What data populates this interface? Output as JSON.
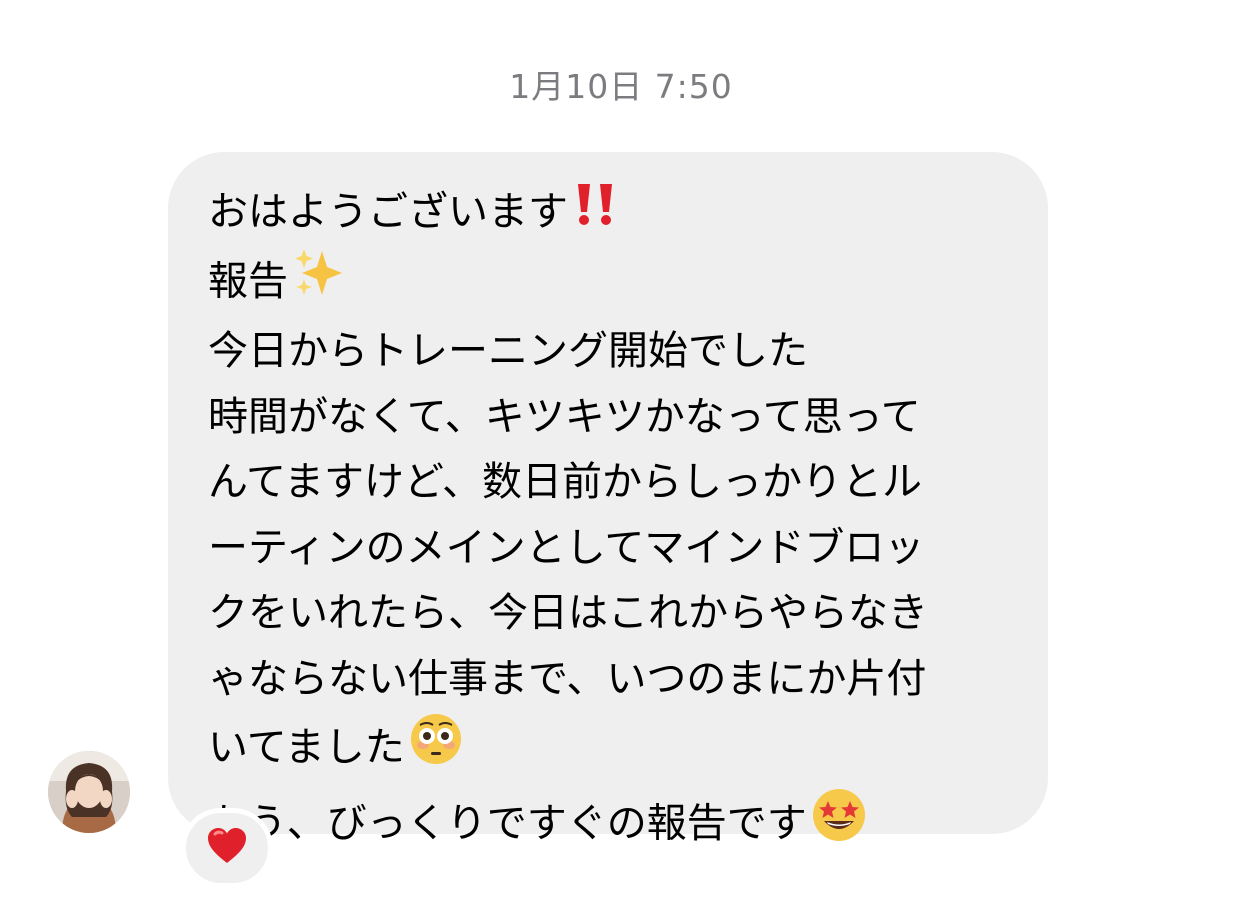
{
  "thread": {
    "timestamp": "1月10日 7:50"
  },
  "message": {
    "lines": [
      "おはようございます",
      "報告",
      "今日からトレーニング開始でした",
      "時間がなくて、キツキツかなって思って",
      "んてますけど、数日前からしっかりとル",
      "ーティンのメインとしてマインドブロッ",
      "クをいれたら、今日はこれからやらなき",
      "ゃならない仕事まで、いつのまにか片付",
      "いてました",
      "もう、びっくりですぐの報告です"
    ],
    "emojis": {
      "line1": "double-exclamation-icon",
      "line2": "sparkles-icon",
      "line9": "flushed-face-icon",
      "line10": "star-struck-face-icon"
    },
    "bubble_color": "#efefef"
  },
  "sender": {
    "avatar": "avatar-photo"
  },
  "reaction": {
    "icon": "red-heart-icon",
    "color": "#e0202a"
  }
}
